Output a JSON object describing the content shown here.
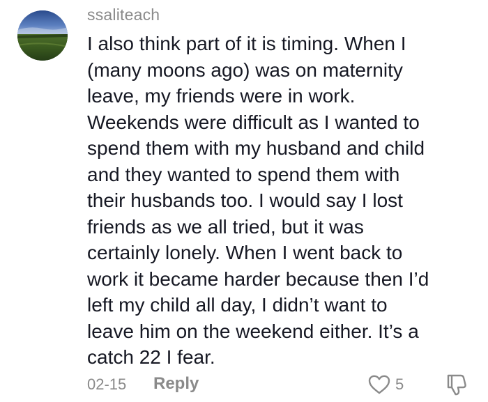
{
  "comment": {
    "username": "ssaliteach",
    "text": "I also think part of it is timing. When I\n(many moons ago) was on maternity\nleave, my friends were in work.\nWeekends were difficult as I wanted to\nspend them with my husband and child\nand they wanted to spend them with\ntheir husbands too. I would say I lost\nfriends as we all tried, but it was\ncertainly lonely. When I went back to\nwork it became harder because then I’d\nleft my child all day, I didn’t want to\nleave him on the weekend either. It’s a\ncatch 22 I fear.",
    "date": "02-15",
    "reply_label": "Reply",
    "like_count": "5"
  },
  "icons": {
    "like": "heart-outline-icon",
    "dislike": "thumbs-down-outline-icon"
  },
  "colors": {
    "text": "#161823",
    "muted": "#8a8a8a",
    "background": "#ffffff"
  }
}
